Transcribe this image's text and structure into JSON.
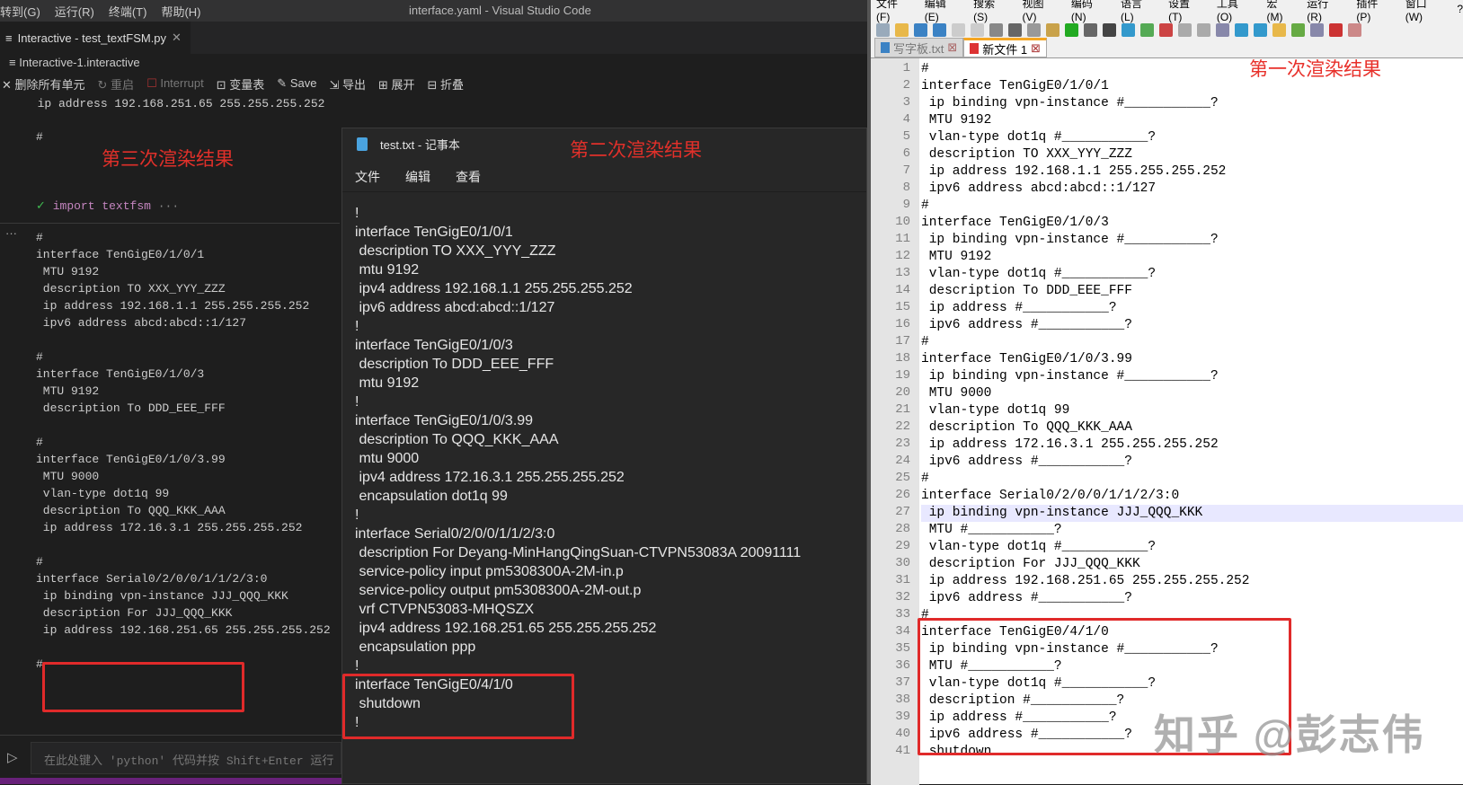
{
  "vscode": {
    "menu": [
      "转到(G)",
      "运行(R)",
      "终端(T)",
      "帮助(H)"
    ],
    "title": "interface.yaml - Visual Studio Code",
    "tab": "Interactive - test_textFSM.py",
    "breadcrumb": "Interactive-1.interactive",
    "toolbar": {
      "clear": "删除所有单元",
      "restart": "重启",
      "interrupt": "Interrupt",
      "variables": "变量表",
      "save": "Save",
      "export": "导出",
      "expand": "展开",
      "collapse": "折叠"
    },
    "top_line": "  ip address 192.168.251.65 255.255.255.252",
    "hash": "#",
    "label": "第三次渲染结果",
    "cell_code": "import textfsm",
    "cell_more": "···",
    "output": "#\ninterface TenGigE0/1/0/1\n MTU 9192\n description TO XXX_YYY_ZZZ\n ip address 192.168.1.1 255.255.255.252\n ipv6 address abcd:abcd::1/127\n\n#\ninterface TenGigE0/1/0/3\n MTU 9192\n description To DDD_EEE_FFF\n\n#\ninterface TenGigE0/1/0/3.99\n MTU 9000\n vlan-type dot1q 99\n description To QQQ_KKK_AAA\n ip address 172.16.3.1 255.255.255.252\n\n#\ninterface Serial0/2/0/0/1/1/2/3:0\n ip binding vpn-instance JJJ_QQQ_KKK\n description For JJJ_QQQ_KKK\n ip address 192.168.251.65 255.255.255.252\n\n#",
    "input_placeholder": "在此处键入 'python' 代码并按 Shift+Enter 运行"
  },
  "notepad": {
    "title": "test.txt - 记事本",
    "label": "第二次渲染结果",
    "menu": [
      "文件",
      "编辑",
      "查看"
    ],
    "text": "!\ninterface TenGigE0/1/0/1\n description TO XXX_YYY_ZZZ\n mtu 9192\n ipv4 address 192.168.1.1 255.255.255.252\n ipv6 address abcd:abcd::1/127\n!\ninterface TenGigE0/1/0/3\n description To DDD_EEE_FFF\n mtu 9192\n!\ninterface TenGigE0/1/0/3.99\n description To QQQ_KKK_AAA\n mtu 9000\n ipv4 address 172.16.3.1 255.255.255.252\n encapsulation dot1q 99\n!\ninterface Serial0/2/0/0/1/1/2/3:0\n description For Deyang-MinHangQingSuan-CTVPN53083A 20091111\n service-policy input pm5308300A-2M-in.p\n service-policy output pm5308300A-2M-out.p\n vrf CTVPN53083-MHQSZX\n ipv4 address 192.168.251.65 255.255.255.252\n encapsulation ppp\n!\ninterface TenGigE0/4/1/0\n shutdown\n!"
  },
  "npp": {
    "menu": [
      "文件(F)",
      "编辑(E)",
      "搜索(S)",
      "视图(V)",
      "编码(N)",
      "语言(L)",
      "设置(T)",
      "工具(O)",
      "宏(M)",
      "运行(R)",
      "插件(P)",
      "窗口(W)",
      "?"
    ],
    "tabs": [
      "写字板.txt",
      "新文件 1"
    ],
    "label": "第一次渲染结果",
    "highlight_line": 27,
    "lines": [
      "#",
      "interface TenGigE0/1/0/1",
      " ip binding vpn-instance #___________?",
      " MTU 9192",
      " vlan-type dot1q #___________?",
      " description TO XXX_YYY_ZZZ",
      " ip address 192.168.1.1 255.255.255.252",
      " ipv6 address abcd:abcd::1/127",
      "#",
      "interface TenGigE0/1/0/3",
      " ip binding vpn-instance #___________?",
      " MTU 9192",
      " vlan-type dot1q #___________?",
      " description To DDD_EEE_FFF",
      " ip address #___________?",
      " ipv6 address #___________?",
      "#",
      "interface TenGigE0/1/0/3.99",
      " ip binding vpn-instance #___________?",
      " MTU 9000",
      " vlan-type dot1q 99",
      " description To QQQ_KKK_AAA",
      " ip address 172.16.3.1 255.255.255.252",
      " ipv6 address #___________?",
      "#",
      "interface Serial0/2/0/0/1/1/2/3:0",
      " ip binding vpn-instance JJJ_QQQ_KKK",
      " MTU #___________?",
      " vlan-type dot1q #___________?",
      " description For JJJ_QQQ_KKK",
      " ip address 192.168.251.65 255.255.255.252",
      " ipv6 address #___________?",
      "#",
      "interface TenGigE0/4/1/0",
      " ip binding vpn-instance #___________?",
      " MTU #___________?",
      " vlan-type dot1q #___________?",
      " description #___________?",
      " ip address #___________?",
      " ipv6 address #___________?",
      " shutdown"
    ]
  },
  "watermark": "知乎 @彭志伟"
}
